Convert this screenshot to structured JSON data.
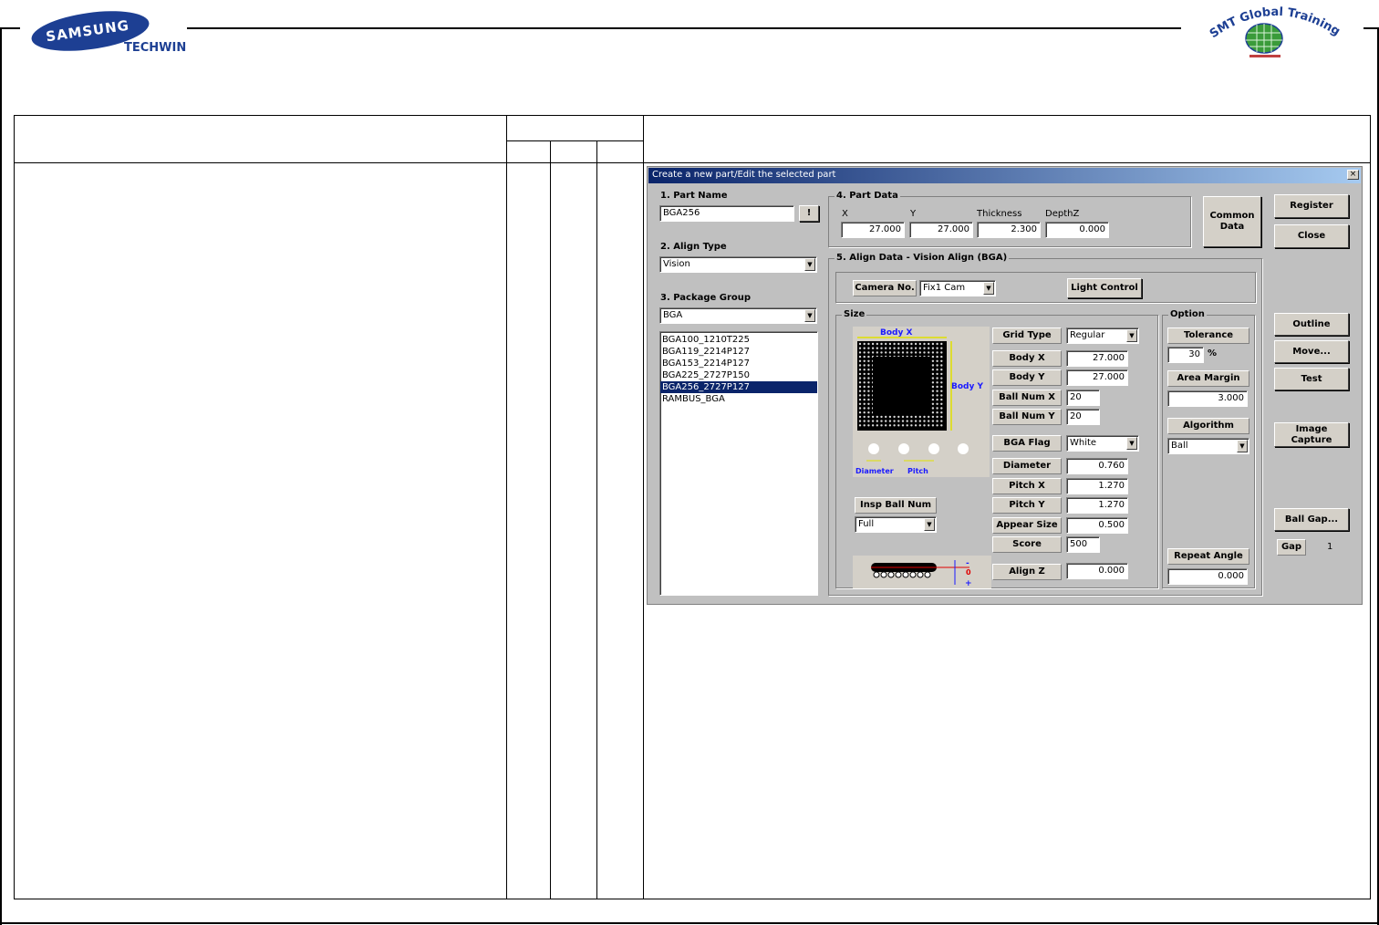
{
  "logos": {
    "samsung": "SAMSUNG",
    "techwin": "TECHWIN",
    "training_center": "SMT Global Training Center"
  },
  "dialog": {
    "title": "Create a new part/Edit the selected part",
    "close_glyph": "×",
    "part_name": {
      "label": "1. Part Name",
      "value": "BGA256",
      "button": "!"
    },
    "align_type": {
      "label": "2. Align Type",
      "value": "Vision"
    },
    "package_group": {
      "label": "3. Package Group",
      "value": "BGA",
      "items": [
        "BGA100_1210T225",
        "BGA119_2214P127",
        "BGA153_2214P127",
        "BGA225_2727P150",
        "BGA256_2727P127",
        "RAMBUS_BGA"
      ],
      "selected_index": 4
    },
    "part_data": {
      "title": "4. Part Data",
      "x_label": "X",
      "x": "27.000",
      "y_label": "Y",
      "y": "27.000",
      "thickness_label": "Thickness",
      "thickness": "2.300",
      "depthz_label": "DepthZ",
      "depthz": "0.000"
    },
    "buttons": {
      "common_data": "Common\nData",
      "register": "Register",
      "close": "Close",
      "outline": "Outline",
      "move": "Move...",
      "test": "Test",
      "image_capture": "Image Capture",
      "ball_gap": "Ball Gap...",
      "light_control": "Light Control"
    },
    "align_data": {
      "title": "5. Align Data - Vision Align (BGA)",
      "camera_label": "Camera No.",
      "camera_value": "Fix1 Cam"
    },
    "size": {
      "title": "Size",
      "body_x_caption": "Body X",
      "body_y_caption": "Body Y",
      "diameter_caption": "Diameter",
      "pitch_caption": "Pitch",
      "insp_ball_num_label": "Insp Ball Num",
      "insp_ball_num_value": "Full",
      "grid_type_label": "Grid Type",
      "grid_type": "Regular",
      "body_x_label": "Body X",
      "body_x": "27.000",
      "body_y_label": "Body Y",
      "body_y": "27.000",
      "ball_num_x_label": "Ball Num X",
      "ball_num_x": "20",
      "ball_num_y_label": "Ball Num Y",
      "ball_num_y": "20",
      "bga_flag_label": "BGA Flag",
      "bga_flag": "White",
      "diameter_label": "Diameter",
      "diameter": "0.760",
      "pitch_x_label": "Pitch X",
      "pitch_x": "1.270",
      "pitch_y_label": "Pitch Y",
      "pitch_y": "1.270",
      "appear_size_label": "Appear Size",
      "appear_size": "0.500",
      "score_label": "Score",
      "score": "500",
      "align_z_label": "Align Z",
      "align_z": "0.000",
      "side_minus": "-",
      "side_zero": "0",
      "side_plus": "+"
    },
    "option": {
      "title": "Option",
      "tolerance_label": "Tolerance",
      "tolerance": "30",
      "tolerance_unit": "%",
      "area_margin_label": "Area Margin",
      "area_margin": "3.000",
      "algorithm_label": "Algorithm",
      "algorithm": "Ball",
      "repeat_angle_label": "Repeat Angle",
      "repeat_angle": "0.000"
    },
    "gap": {
      "label": "Gap",
      "value": "1"
    }
  },
  "colors": {
    "title_bar_start": "#0a246a",
    "samsung_blue": "#1d3f93",
    "dialog_face": "#c0c0c0",
    "diagram_accent": "#1a1aff"
  }
}
